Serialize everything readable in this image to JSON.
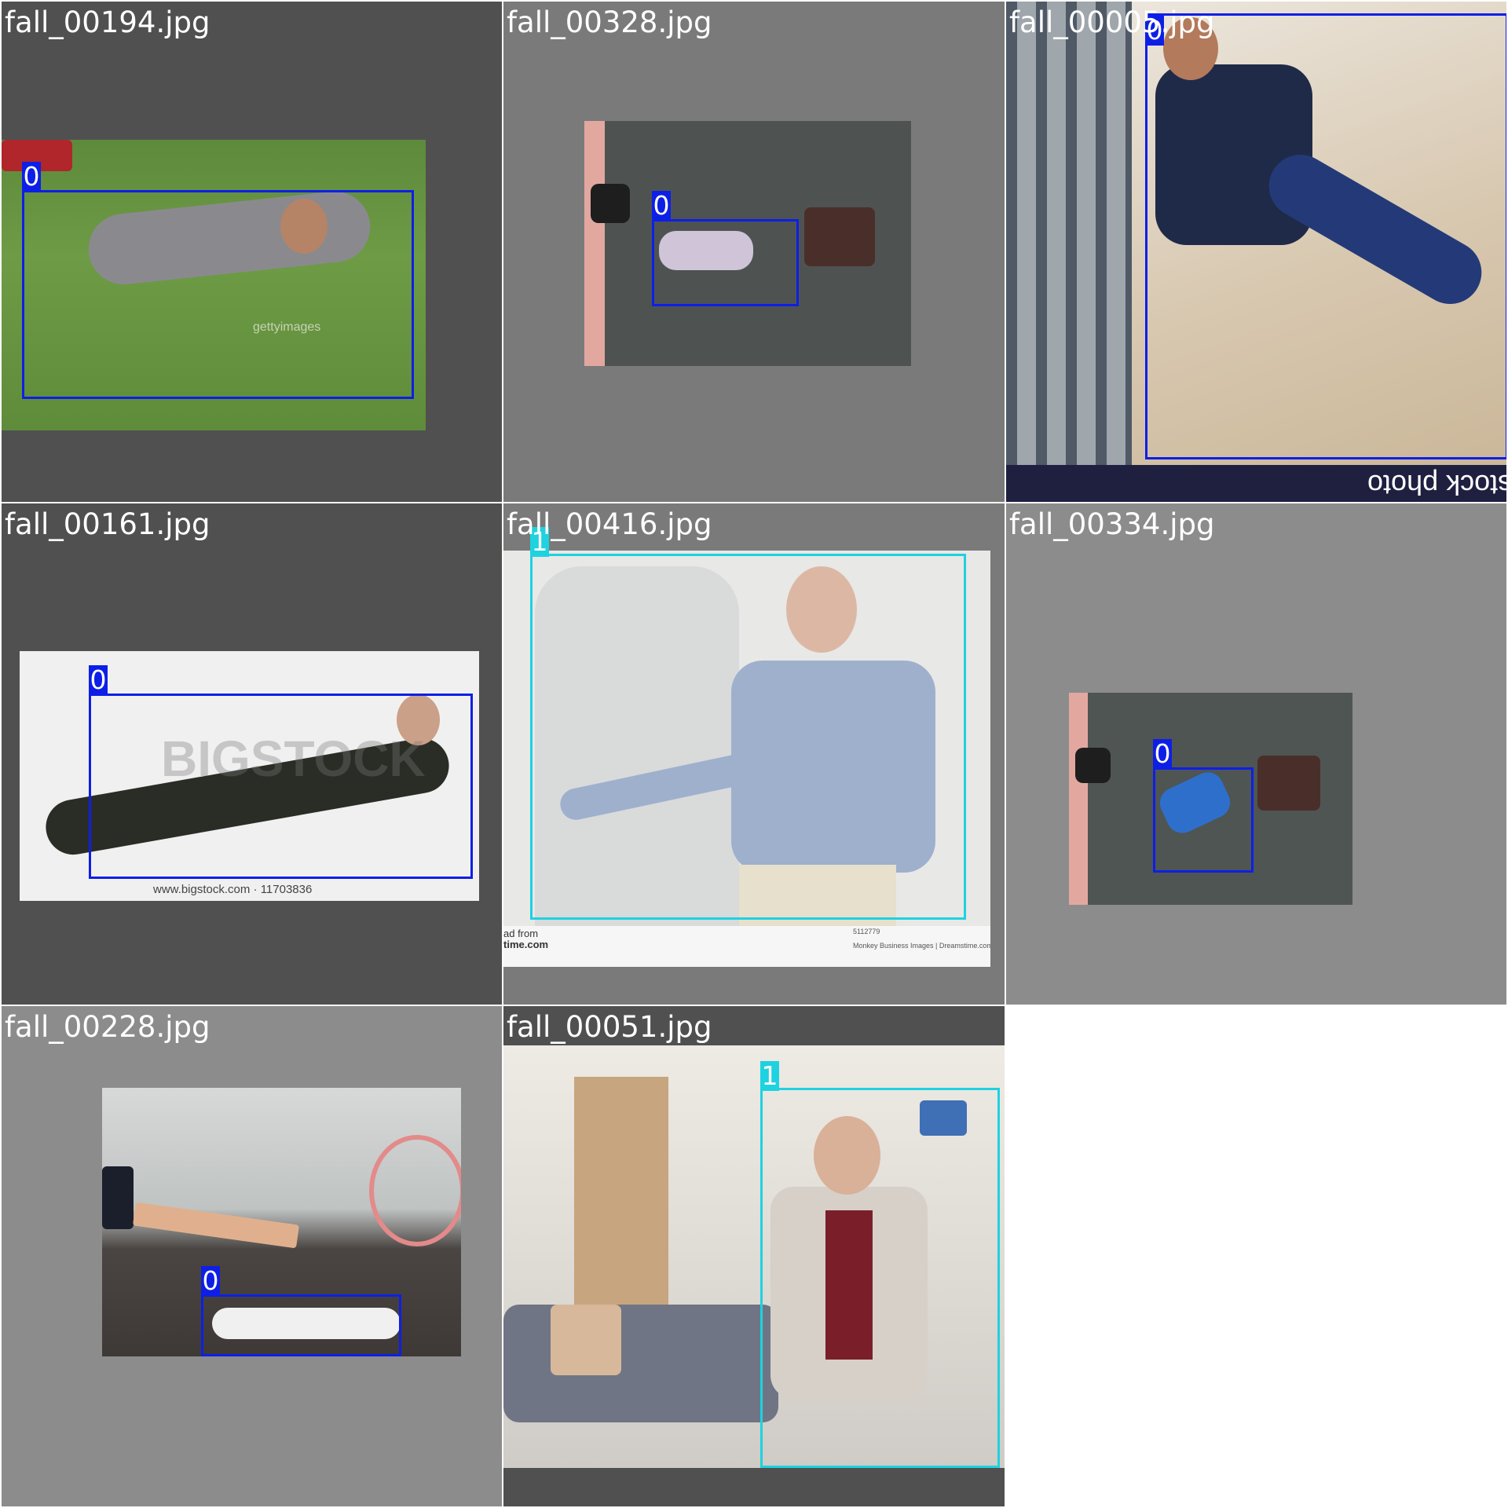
{
  "colors": {
    "class_0": "#0d1fe6",
    "class_1": "#1ed2e0",
    "tile_bg_dark": "#505050",
    "tile_bg_mid": "#7a7a7a",
    "tile_bg_light": "#8c8c8c"
  },
  "tiles": [
    {
      "filename": "fall_00194.jpg",
      "labels": [
        "0"
      ],
      "watermark": "gettyimages"
    },
    {
      "filename": "fall_00328.jpg",
      "labels": [
        "0"
      ]
    },
    {
      "filename": "fall_00005.jpg",
      "labels": [
        "0"
      ],
      "watermark": "stock photo"
    },
    {
      "filename": "fall_00161.jpg",
      "labels": [
        "0"
      ],
      "watermark": "BIGSTOCK",
      "caption": "www.bigstock.com · 11703836"
    },
    {
      "filename": "fall_00416.jpg",
      "labels": [
        "1"
      ],
      "caption_left": "ad from",
      "caption_left2": "time.com",
      "caption_right1": "5112779",
      "caption_right2": "Monkey Business Images | Dreamstime.com"
    },
    {
      "filename": "fall_00334.jpg",
      "labels": [
        "0"
      ]
    },
    {
      "filename": "fall_00228.jpg",
      "labels": [
        "0"
      ]
    },
    {
      "filename": "fall_00051.jpg",
      "labels": [
        "1"
      ]
    }
  ]
}
